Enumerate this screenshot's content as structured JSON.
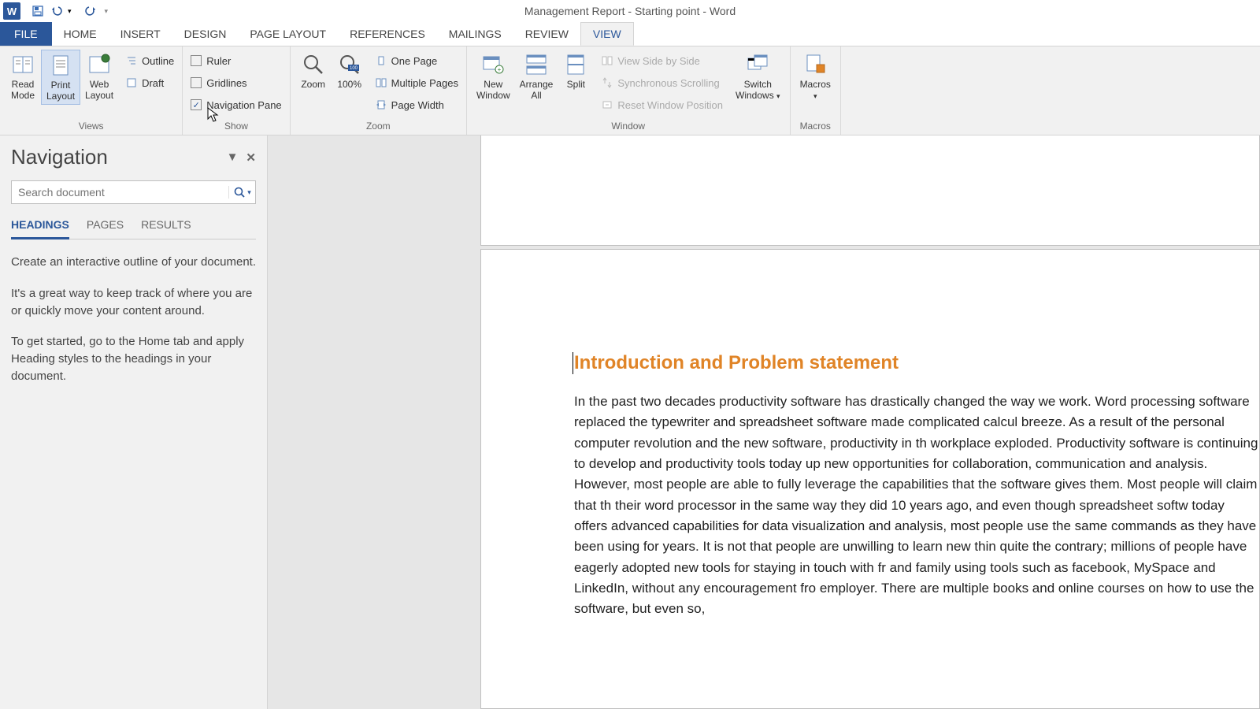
{
  "app": {
    "title": "Management Report - Starting point - Word"
  },
  "tabs": {
    "file": "FILE",
    "home": "HOME",
    "insert": "INSERT",
    "design": "DESIGN",
    "page_layout": "PAGE LAYOUT",
    "references": "REFERENCES",
    "mailings": "MAILINGS",
    "review": "REVIEW",
    "view": "VIEW"
  },
  "ribbon": {
    "views": {
      "read_mode": "Read\nMode",
      "print_layout": "Print\nLayout",
      "web_layout": "Web\nLayout",
      "outline": "Outline",
      "draft": "Draft",
      "group": "Views"
    },
    "show": {
      "ruler": "Ruler",
      "gridlines": "Gridlines",
      "navigation_pane": "Navigation Pane",
      "group": "Show"
    },
    "zoom": {
      "zoom": "Zoom",
      "hundred": "100%",
      "one_page": "One Page",
      "multiple_pages": "Multiple Pages",
      "page_width": "Page Width",
      "group": "Zoom"
    },
    "window": {
      "new_window": "New\nWindow",
      "arrange_all": "Arrange\nAll",
      "split": "Split",
      "side_by_side": "View Side by Side",
      "sync_scroll": "Synchronous Scrolling",
      "reset_pos": "Reset Window Position",
      "switch_windows": "Switch\nWindows",
      "group": "Window"
    },
    "macros": {
      "macros": "Macros",
      "group": "Macros"
    }
  },
  "navpane": {
    "title": "Navigation",
    "search_placeholder": "Search document",
    "tabs": {
      "headings": "HEADINGS",
      "pages": "PAGES",
      "results": "RESULTS"
    },
    "help1": "Create an interactive outline of your document.",
    "help2": "It's a great way to keep track of where you are or quickly move your content around.",
    "help3": "To get started, go to the Home tab and apply Heading styles to the headings in your document."
  },
  "document": {
    "heading": "Introduction and Problem statement",
    "body_pre": "In the past two decades productivity software has drastically changed the way we work. Word processing software replaced the typewriter and spreadsheet software made complicated calcul breeze. As a result of the personal computer revolution and the new software, productivity in th workplace exploded. Productivity software is continuing to develop and productivity tools today up new opportunities for collaboration, communication and analysis. However, most people are able to fully leverage the capabilities that the software gives them. Most people will claim that th their word processor in the same way they did 10 years ago, and even though spreadsheet softw today offers advanced capabilities for data visualization and analysis, most people use the same commands as they have been using for years. It is not that people are unwilling to learn new thin quite the contrary; millions of people have eagerly adopted new tools for staying in touch with fr and family using tools such as ",
    "err1": "facebook",
    "mid": ", ",
    "err2": "MySpace",
    "body_post": " and LinkedIn, without any encouragement fro employer. There are multiple books and online courses on how to use the software, but even so, "
  }
}
